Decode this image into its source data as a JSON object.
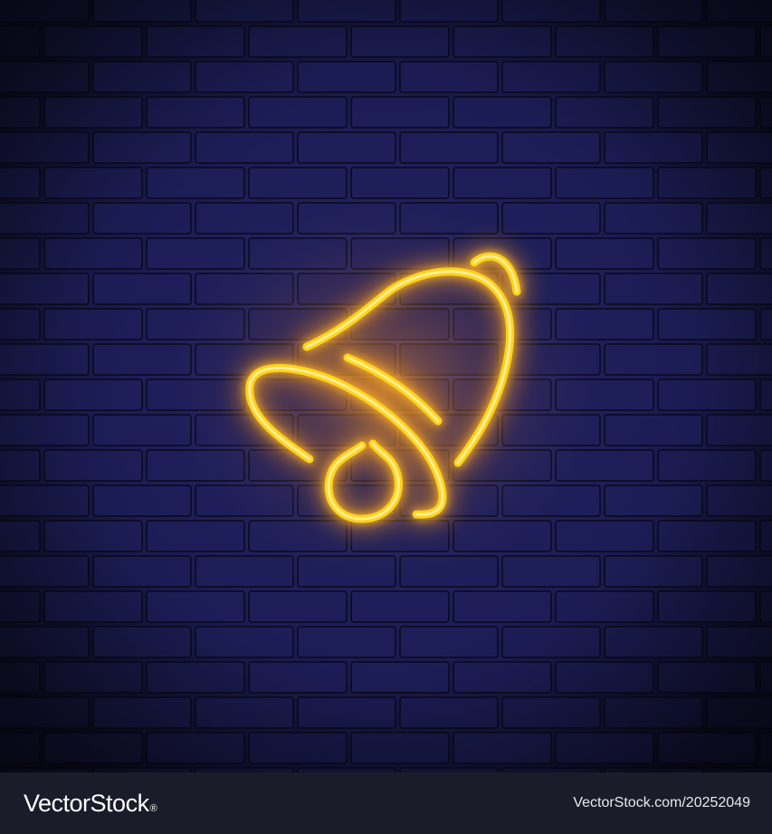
{
  "scene": {
    "subject": "neon-bell-sign",
    "colors": {
      "wall_dark": "#0c0e22",
      "wall_mid": "#1e1f5a",
      "mortar": "#080918",
      "neon_core": "#ffe86a",
      "neon_tube": "#ffd21a",
      "neon_glow": "#ffa21e"
    }
  },
  "footer": {
    "brand": "VectorStock",
    "registered_mark": "®",
    "image_id": "VectorStock.com/20252049"
  }
}
